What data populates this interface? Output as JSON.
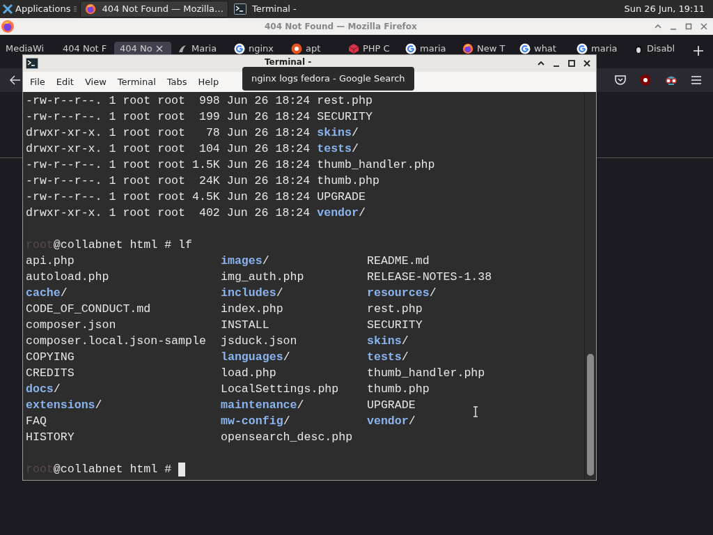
{
  "panel": {
    "applications": "Applications",
    "tasks": [
      {
        "label": "404 Not Found — Mozilla…",
        "kind": "firefox",
        "selected": true
      },
      {
        "label": "Terminal -",
        "kind": "terminal",
        "selected": false
      }
    ],
    "clock": "Sun 26 Jun, 19:11"
  },
  "firefox": {
    "title": "404 Not Found — Mozilla Firefox",
    "tabs": [
      {
        "label": "MediaWi",
        "selected": false
      },
      {
        "label": "404 Not F",
        "selected": false
      },
      {
        "label": "404 No",
        "selected": true
      },
      {
        "label": "Maria",
        "selected": false
      },
      {
        "label": "nginx",
        "selected": false
      },
      {
        "label": "apt",
        "selected": false
      },
      {
        "label": "PHP C",
        "selected": false
      },
      {
        "label": "maria",
        "selected": false
      },
      {
        "label": "New T",
        "selected": false
      },
      {
        "label": "what",
        "selected": false
      },
      {
        "label": "maria",
        "selected": false
      },
      {
        "label": "Disabl",
        "selected": false
      }
    ],
    "tooltip": "nginx logs fedora - Google Search"
  },
  "terminal": {
    "title": "Terminal -",
    "menu": [
      "File",
      "Edit",
      "View",
      "Terminal",
      "Tabs",
      "Help"
    ],
    "long_listing": [
      {
        "prefix": "-rw-r--r--. 1 root root  998 Jun 26 18:24 ",
        "name": "rest.php",
        "kind": "file"
      },
      {
        "prefix": "-rw-r--r--. 1 root root  199 Jun 26 18:24 ",
        "name": "SECURITY",
        "kind": "file"
      },
      {
        "prefix": "drwxr-xr-x. 1 root root   78 Jun 26 18:24 ",
        "name": "skins",
        "suffix": "/",
        "kind": "dir"
      },
      {
        "prefix": "drwxr-xr-x. 1 root root  104 Jun 26 18:24 ",
        "name": "tests",
        "suffix": "/",
        "kind": "dir"
      },
      {
        "prefix": "-rw-r--r--. 1 root root 1.5K Jun 26 18:24 ",
        "name": "thumb_handler.php",
        "kind": "file"
      },
      {
        "prefix": "-rw-r--r--. 1 root root  24K Jun 26 18:24 ",
        "name": "thumb.php",
        "kind": "file"
      },
      {
        "prefix": "-rw-r--r--. 1 root root 4.5K Jun 26 18:24 ",
        "name": "UPGRADE",
        "kind": "file"
      },
      {
        "prefix": "drwxr-xr-x. 1 root root  402 Jun 26 18:24 ",
        "name": "vendor",
        "suffix": "/",
        "kind": "dir"
      }
    ],
    "prompt1": {
      "user": "root",
      "host": "@collabnet html # ",
      "command": "lf"
    },
    "columns": [
      [
        {
          "name": "api.php",
          "kind": "file"
        },
        {
          "name": "autoload.php",
          "kind": "file"
        },
        {
          "name": "cache",
          "suffix": "/",
          "kind": "dir"
        },
        {
          "name": "CODE_OF_CONDUCT.md",
          "kind": "file"
        },
        {
          "name": "composer.json",
          "kind": "file"
        },
        {
          "name": "composer.local.json-sample",
          "kind": "file"
        },
        {
          "name": "COPYING",
          "kind": "file"
        },
        {
          "name": "CREDITS",
          "kind": "file"
        },
        {
          "name": "docs",
          "suffix": "/",
          "kind": "dir"
        },
        {
          "name": "extensions",
          "suffix": "/",
          "kind": "dir"
        },
        {
          "name": "FAQ",
          "kind": "file"
        },
        {
          "name": "HISTORY",
          "kind": "file"
        }
      ],
      [
        {
          "name": "images",
          "suffix": "/",
          "kind": "dir"
        },
        {
          "name": "img_auth.php",
          "kind": "file"
        },
        {
          "name": "includes",
          "suffix": "/",
          "kind": "dir"
        },
        {
          "name": "index.php",
          "kind": "file"
        },
        {
          "name": "INSTALL",
          "kind": "file"
        },
        {
          "name": "jsduck.json",
          "kind": "file"
        },
        {
          "name": "languages",
          "suffix": "/",
          "kind": "dir"
        },
        {
          "name": "load.php",
          "kind": "file"
        },
        {
          "name": "LocalSettings.php",
          "kind": "file"
        },
        {
          "name": "maintenance",
          "suffix": "/",
          "kind": "dir"
        },
        {
          "name": "mw-config",
          "suffix": "/",
          "kind": "dir"
        },
        {
          "name": "opensearch_desc.php",
          "kind": "file"
        }
      ],
      [
        {
          "name": "README.md",
          "kind": "file"
        },
        {
          "name": "RELEASE-NOTES-1.38",
          "kind": "file"
        },
        {
          "name": "resources",
          "suffix": "/",
          "kind": "dir"
        },
        {
          "name": "rest.php",
          "kind": "file"
        },
        {
          "name": "SECURITY",
          "kind": "file"
        },
        {
          "name": "skins",
          "suffix": "/",
          "kind": "dir"
        },
        {
          "name": "tests",
          "suffix": "/",
          "kind": "dir"
        },
        {
          "name": "thumb_handler.php",
          "kind": "file"
        },
        {
          "name": "thumb.php",
          "kind": "file"
        },
        {
          "name": "UPGRADE",
          "kind": "file"
        },
        {
          "name": "vendor",
          "suffix": "/",
          "kind": "dir"
        }
      ]
    ],
    "prompt2": {
      "user": "root",
      "host": "@collabnet html # "
    }
  }
}
